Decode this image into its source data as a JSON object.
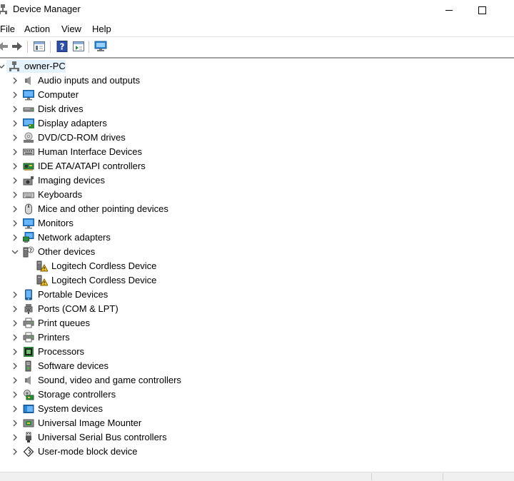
{
  "window": {
    "title": "Device Manager"
  },
  "menu": {
    "file": "File",
    "action": "Action",
    "view": "View",
    "help": "Help"
  },
  "tree": {
    "root": {
      "label": "owner-PC",
      "icon": "computer-network-icon"
    },
    "categories": [
      {
        "label": "Audio inputs and outputs",
        "icon": "speaker-icon",
        "expanded": false
      },
      {
        "label": "Computer",
        "icon": "monitor-icon",
        "expanded": false
      },
      {
        "label": "Disk drives",
        "icon": "disk-drive-icon",
        "expanded": false
      },
      {
        "label": "Display adapters",
        "icon": "display-adapter-icon",
        "expanded": false
      },
      {
        "label": "DVD/CD-ROM drives",
        "icon": "dvd-drive-icon",
        "expanded": false
      },
      {
        "label": "Human Interface Devices",
        "icon": "hid-icon",
        "expanded": false
      },
      {
        "label": "IDE ATA/ATAPI controllers",
        "icon": "ide-controller-icon",
        "expanded": false
      },
      {
        "label": "Imaging devices",
        "icon": "camera-icon",
        "expanded": false
      },
      {
        "label": "Keyboards",
        "icon": "keyboard-icon",
        "expanded": false
      },
      {
        "label": "Mice and other pointing devices",
        "icon": "mouse-icon",
        "expanded": false
      },
      {
        "label": "Monitors",
        "icon": "monitor-icon",
        "expanded": false
      },
      {
        "label": "Network adapters",
        "icon": "network-adapter-icon",
        "expanded": false
      },
      {
        "label": "Other devices",
        "icon": "unknown-device-icon",
        "expanded": true,
        "children": [
          {
            "label": "Logitech Cordless Device",
            "icon": "warning-device-icon"
          },
          {
            "label": "Logitech Cordless Device",
            "icon": "warning-device-icon"
          }
        ]
      },
      {
        "label": "Portable Devices",
        "icon": "portable-device-icon",
        "expanded": false
      },
      {
        "label": "Ports (COM & LPT)",
        "icon": "port-icon",
        "expanded": false
      },
      {
        "label": "Print queues",
        "icon": "printer-icon",
        "expanded": false
      },
      {
        "label": "Printers",
        "icon": "printer-icon",
        "expanded": false
      },
      {
        "label": "Processors",
        "icon": "processor-icon",
        "expanded": false
      },
      {
        "label": "Software devices",
        "icon": "software-device-icon",
        "expanded": false
      },
      {
        "label": "Sound, video and game controllers",
        "icon": "speaker-icon",
        "expanded": false
      },
      {
        "label": "Storage controllers",
        "icon": "storage-controller-icon",
        "expanded": false
      },
      {
        "label": "System devices",
        "icon": "system-device-icon",
        "expanded": false
      },
      {
        "label": "Universal Image Mounter",
        "icon": "image-mounter-icon",
        "expanded": false
      },
      {
        "label": "Universal Serial Bus controllers",
        "icon": "usb-icon",
        "expanded": false
      },
      {
        "label": "User-mode block device",
        "icon": "block-device-icon",
        "expanded": false
      }
    ]
  },
  "colors": {
    "selection": "#e5f1fb",
    "accent": "#2b86d6",
    "warning": "#f5c518"
  }
}
